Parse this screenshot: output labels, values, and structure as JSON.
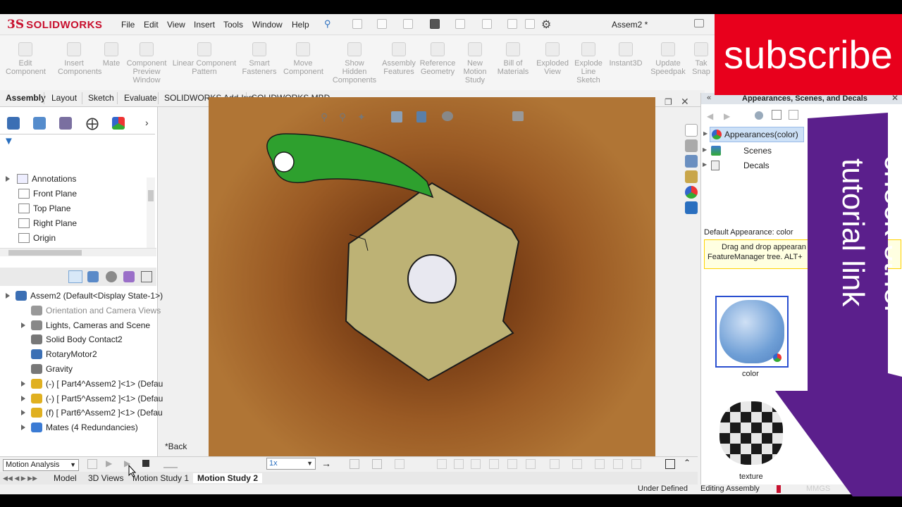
{
  "app": {
    "brand_ds": "3S",
    "brand_name": "SOLIDWORKS",
    "doc_title": "Assem2 *"
  },
  "menu": [
    "File",
    "Edit",
    "View",
    "Insert",
    "Tools",
    "Window",
    "Help"
  ],
  "command_manager": {
    "buttons": [
      {
        "label": "Edit\nComponent"
      },
      {
        "label": "Insert\nComponents"
      },
      {
        "label": "Mate"
      },
      {
        "label": "Component\nPreview\nWindow"
      },
      {
        "label": "Linear Component\nPattern"
      },
      {
        "label": "Smart\nFasteners"
      },
      {
        "label": "Move\nComponent"
      },
      {
        "label": "Show\nHidden\nComponents"
      },
      {
        "label": "Assembly\nFeatures"
      },
      {
        "label": "Reference\nGeometry"
      },
      {
        "label": "New\nMotion\nStudy"
      },
      {
        "label": "Bill of\nMaterials"
      },
      {
        "label": "Exploded\nView"
      },
      {
        "label": "Explode\nLine\nSketch"
      },
      {
        "label": "Instant3D"
      },
      {
        "label": "Update\nSpeedpak"
      },
      {
        "label": "Tak\nSnap"
      }
    ],
    "tabs": [
      "Assembly",
      "Layout",
      "Sketch",
      "Evaluate",
      "SOLIDWORKS Add-Ins",
      "SOLIDWORKS MBD"
    ]
  },
  "feature_tree_top": [
    "Annotations",
    "Front Plane",
    "Top Plane",
    "Right Plane",
    "Origin"
  ],
  "feature_tree": [
    {
      "label": "Assem2  (Default<Display State-1>)",
      "muted": false
    },
    {
      "label": "Orientation and Camera Views",
      "muted": true
    },
    {
      "label": "Lights, Cameras and Scene",
      "muted": false
    },
    {
      "label": "Solid Body Contact2",
      "muted": false
    },
    {
      "label": "RotaryMotor2",
      "muted": false
    },
    {
      "label": "Gravity",
      "muted": false
    },
    {
      "label": "(-) [ Part4^Assem2 ]<1> (Defau",
      "muted": false
    },
    {
      "label": "(-) [ Part5^Assem2 ]<1> (Defau",
      "muted": false
    },
    {
      "label": "(f) [ Part6^Assem2 ]<1> (Defau",
      "muted": false
    },
    {
      "label": "Mates (4 Redundancies)",
      "muted": false
    }
  ],
  "viewport": {
    "view_label": "*Back"
  },
  "motion": {
    "analysis_type": "Motion Analysis",
    "speed": "1x"
  },
  "bottom_tabs": [
    "Model",
    "3D Views",
    "Motion Study 1",
    "Motion Study 2"
  ],
  "status": {
    "left": "Under Defined",
    "right": "Editing Assembly",
    "units": "MMGS"
  },
  "right_panel": {
    "title": "Appearances, Scenes, and Decals",
    "tree": [
      "Appearances(color)",
      "Scenes",
      "Decals"
    ],
    "default_label": "Default Appearance: color",
    "hint_line1": "Drag and drop appearan",
    "hint_line2": "FeatureManager tree.  ALT+",
    "swatches": [
      "color",
      "texture"
    ]
  },
  "overlays": {
    "subscribe": "subscribe",
    "arrow_line1": "check other",
    "arrow_line2": "tutorial link"
  },
  "colors": {
    "brand_red": "#c8102e",
    "subscribe_red": "#e8001c",
    "arrow_purple": "#5b1f8c",
    "pawl_green": "#2ea02e",
    "ratchet_khaki": "#bdb275"
  }
}
